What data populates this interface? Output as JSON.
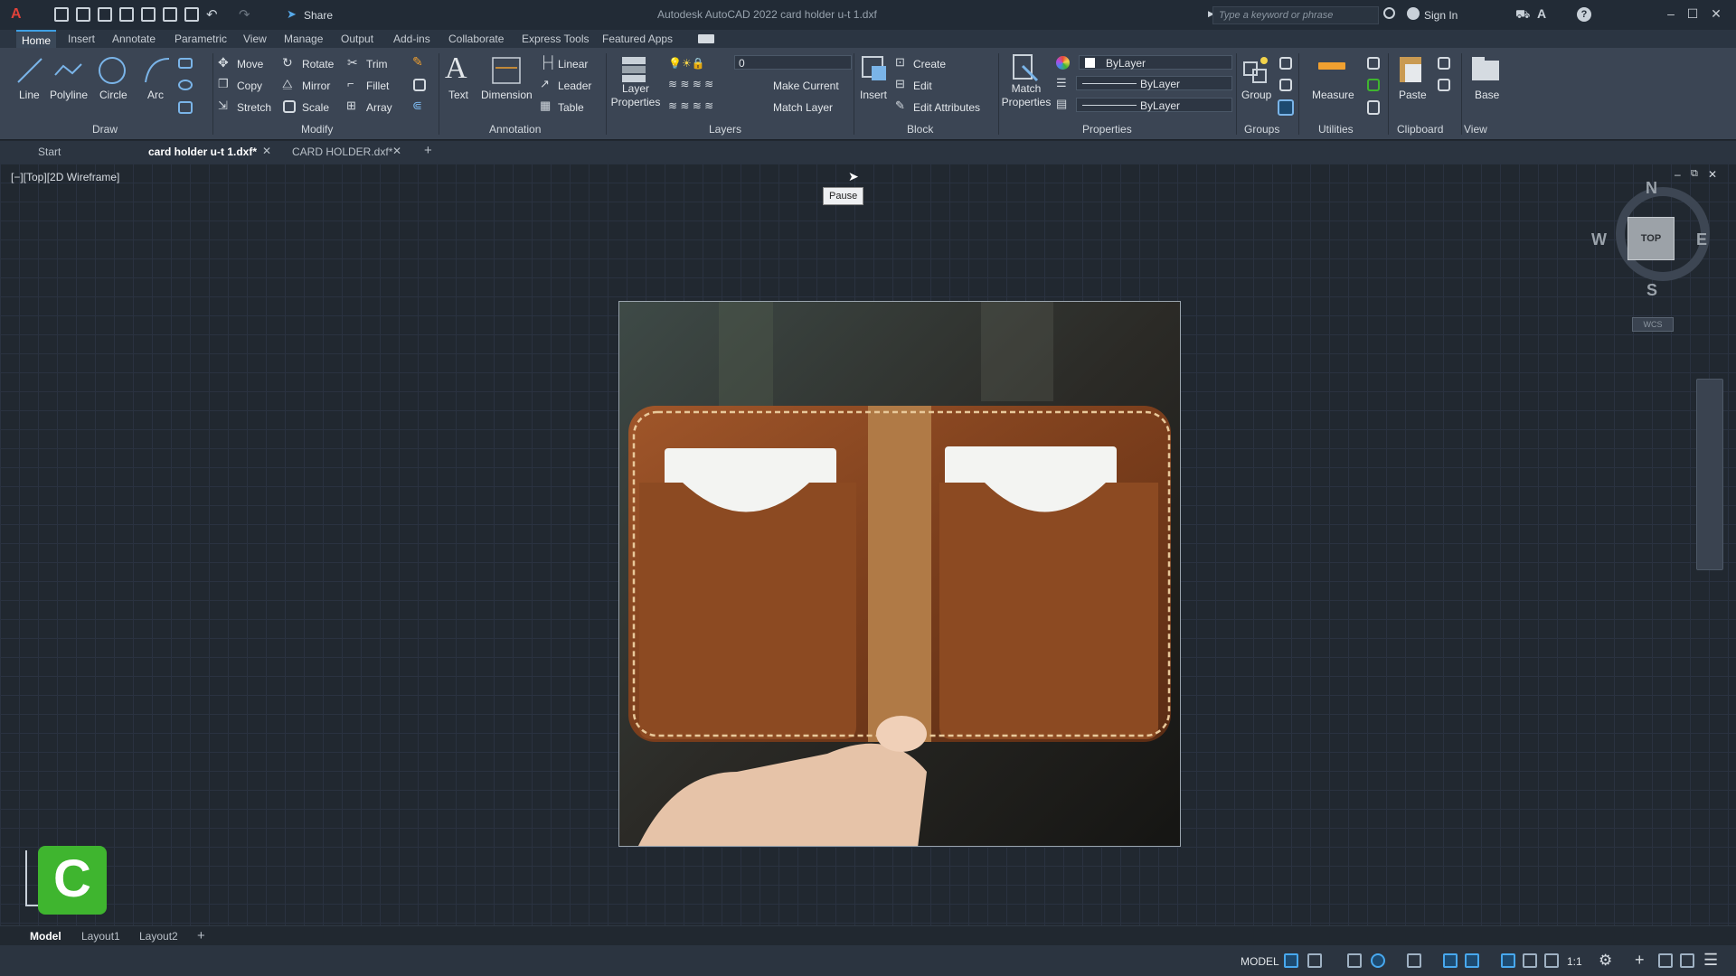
{
  "title_bar": {
    "share_label": "Share",
    "app_title": "Autodesk AutoCAD 2022   card holder u-t 1.dxf",
    "search_placeholder": "Type a keyword or phrase",
    "sign_in_label": "Sign In"
  },
  "ribbon_tabs": [
    "Home",
    "Insert",
    "Annotate",
    "Parametric",
    "View",
    "Manage",
    "Output",
    "Add-ins",
    "Collaborate",
    "Express Tools",
    "Featured Apps"
  ],
  "draw_panel": {
    "title": "Draw",
    "line": "Line",
    "polyline": "Polyline",
    "circle": "Circle",
    "arc": "Arc"
  },
  "modify_panel": {
    "title": "Modify",
    "move": "Move",
    "rotate": "Rotate",
    "trim": "Trim",
    "copy": "Copy",
    "mirror": "Mirror",
    "fillet": "Fillet",
    "stretch": "Stretch",
    "scale": "Scale",
    "array": "Array"
  },
  "annotation_panel": {
    "title": "Annotation",
    "text": "Text",
    "dimension": "Dimension",
    "linear": "Linear",
    "leader": "Leader",
    "table": "Table"
  },
  "layers_panel": {
    "title": "Layers",
    "layer_properties": "Layer Properties",
    "current_layer": "0",
    "make_current": "Make Current",
    "match_layer": "Match Layer"
  },
  "block_panel": {
    "title": "Block",
    "insert": "Insert",
    "create": "Create",
    "edit": "Edit",
    "edit_attributes": "Edit Attributes"
  },
  "properties_panel": {
    "title": "Properties",
    "match_properties": "Match Properties",
    "color": "ByLayer",
    "linetype": "ByLayer",
    "lineweight": "ByLayer"
  },
  "groups_panel": {
    "title": "Groups",
    "group": "Group"
  },
  "utilities_panel": {
    "title": "Utilities",
    "measure": "Measure"
  },
  "clipboard_panel": {
    "title": "Clipboard",
    "paste": "Paste"
  },
  "view_panel": {
    "title": "View",
    "base": "Base"
  },
  "document_tabs": [
    {
      "label": "Start"
    },
    {
      "label": "card holder u-t 1.dxf*"
    },
    {
      "label": "CARD HOLDER.dxf*"
    }
  ],
  "viewport_label": "[−][Top][2D Wireframe]",
  "tooltip": "Pause",
  "viewcube": {
    "top": "TOP",
    "north": "N",
    "south": "S",
    "east": "E",
    "west": "W",
    "wcs": "WCS"
  },
  "layout_tabs": [
    "Model",
    "Layout1",
    "Layout2"
  ],
  "status_bar": {
    "model_label": "MODEL",
    "scale_label": "1:1"
  },
  "colors": {
    "accent": "#3ea0e4",
    "ribbon": "#3b4554",
    "canvas": "#212830",
    "leather": "#8a4a22",
    "camtasia": "#3fb52f"
  }
}
